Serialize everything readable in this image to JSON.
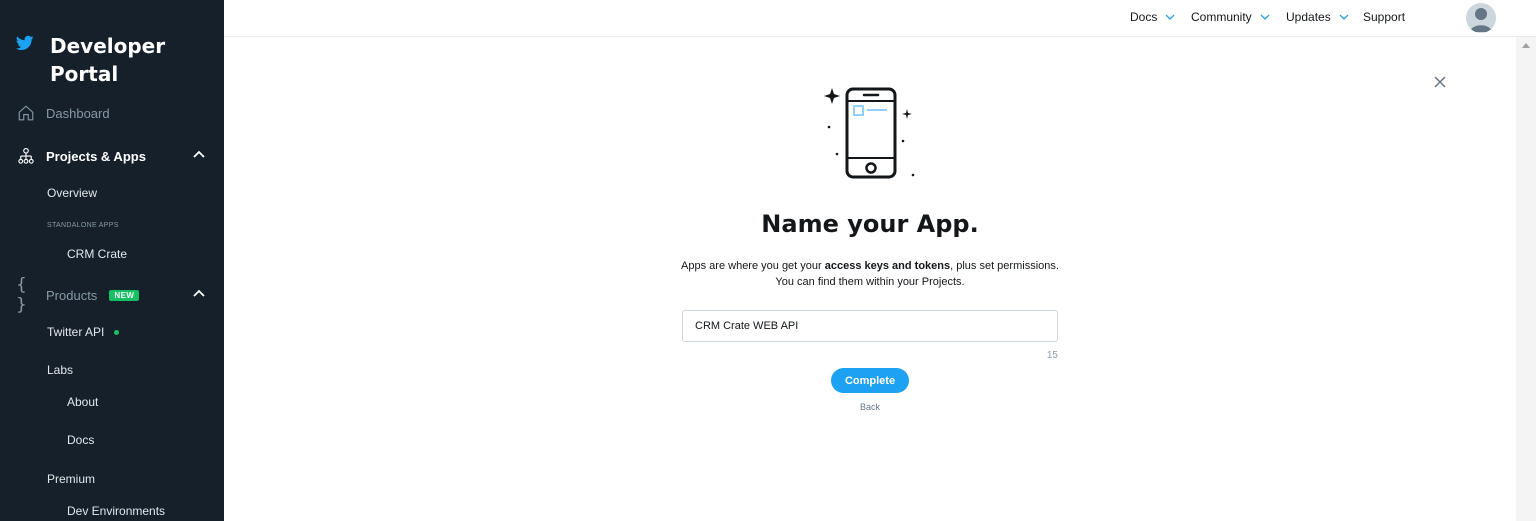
{
  "sidebar": {
    "brand": "Developer Portal",
    "dashboard": "Dashboard",
    "projects_apps": "Projects & Apps",
    "overview": "Overview",
    "standalone_apps": "STANDALONE APPS",
    "crm_crate": "CRM Crate",
    "products": "Products",
    "new_badge": "NEW",
    "twitter_api": "Twitter API",
    "labs": "Labs",
    "about": "About",
    "docs": "Docs",
    "premium": "Premium",
    "dev_environments": "Dev Environments"
  },
  "topbar": {
    "docs": "Docs",
    "community": "Community",
    "updates": "Updates",
    "support": "Support"
  },
  "main": {
    "title": "Name your App.",
    "desc_prefix": "Apps are where you get your ",
    "desc_bold": "access keys and tokens",
    "desc_suffix": ", plus set permissions.",
    "desc_line2": "You can find them within your Projects.",
    "app_name_value": "CRM Crate WEB API",
    "char_count": "15",
    "complete_label": "Complete",
    "back_label": "Back"
  },
  "colors": {
    "sidebar_bg": "#15202b",
    "accent": "#1da1f2",
    "badge_green": "#17bf63"
  },
  "icons": [
    "twitter-bird-icon",
    "home-icon",
    "projects-tree-icon",
    "braces-icon",
    "chevron-up-icon",
    "chevron-down-icon",
    "close-icon",
    "user-avatar-icon",
    "phone-illustration"
  ]
}
